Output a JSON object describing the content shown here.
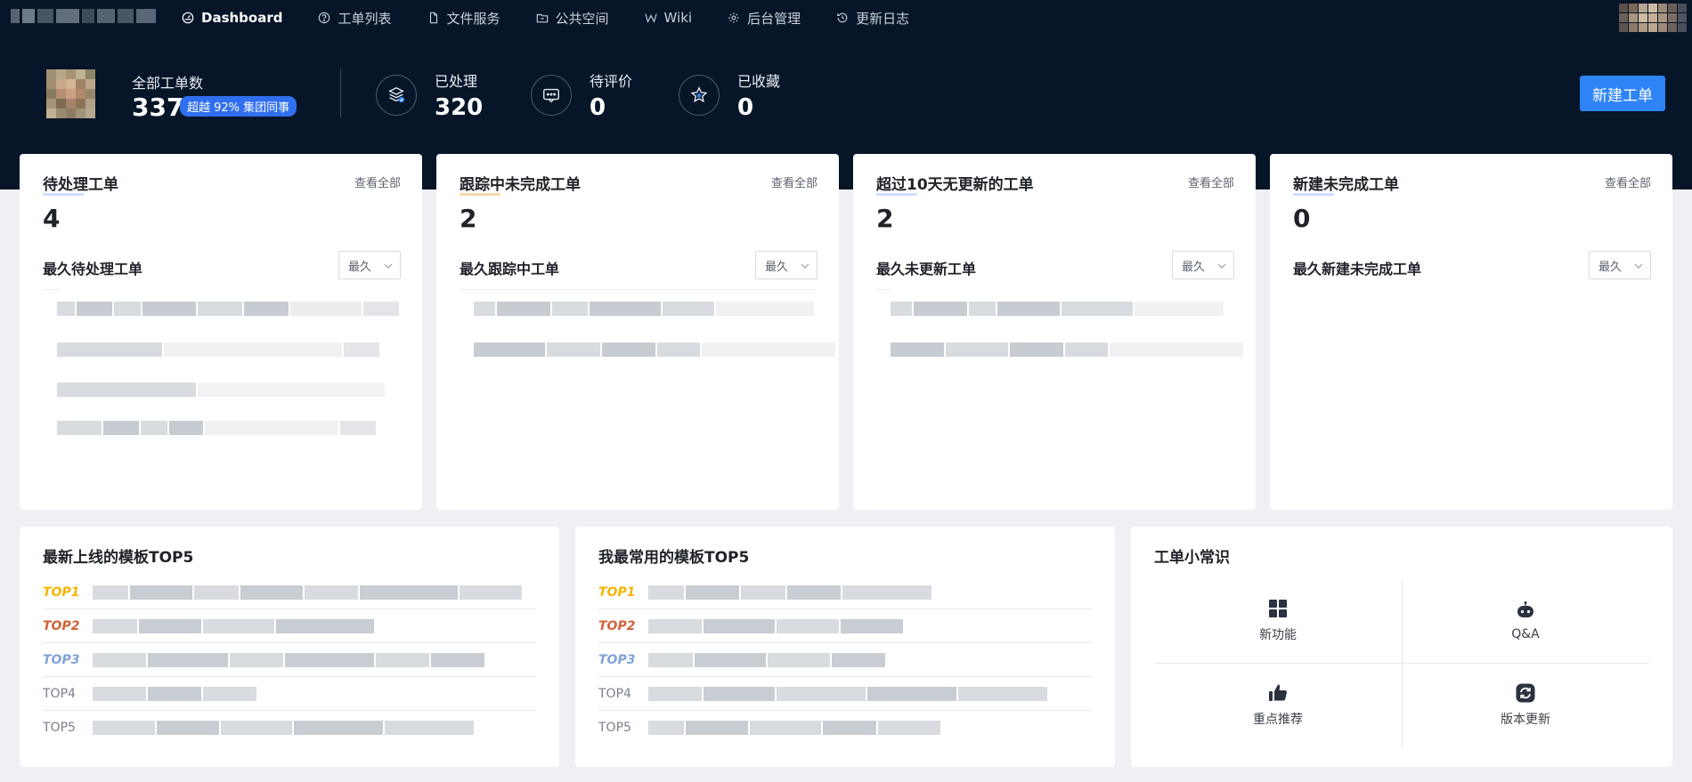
{
  "colors": {
    "header_bg": "#061528",
    "accent": "#2f84f5",
    "badge": "#2f6ff0",
    "top1": "#f5b400",
    "top2": "#d0623a",
    "top3": "#7fa3d6"
  },
  "nav": {
    "items": [
      {
        "label": "Dashboard",
        "icon": "dashboard-icon",
        "active": true
      },
      {
        "label": "工单列表",
        "icon": "help-circle-icon"
      },
      {
        "label": "文件服务",
        "icon": "file-icon"
      },
      {
        "label": "公共空间",
        "icon": "folder-icon"
      },
      {
        "label": "Wiki",
        "icon": "wiki-icon"
      },
      {
        "label": "后台管理",
        "icon": "gear-icon"
      },
      {
        "label": "更新日志",
        "icon": "history-icon"
      }
    ]
  },
  "summary": {
    "total_label": "全部工单数",
    "total_value": "337",
    "total_badge": "超越 92% 集团同事",
    "stats": [
      {
        "label": "已处理",
        "value": "320",
        "icon": "layers-check-icon"
      },
      {
        "label": "待评价",
        "value": "0",
        "icon": "message-icon"
      },
      {
        "label": "已收藏",
        "value": "0",
        "icon": "star-icon"
      }
    ],
    "new_button": "新建工单"
  },
  "cards": [
    {
      "title": "待处理工单",
      "view_all": "查看全部",
      "count": "4",
      "sub_title": "最久待处理工单",
      "sort": "最久"
    },
    {
      "title": "跟踪中未完成工单",
      "view_all": "查看全部",
      "count": "2",
      "sub_title": "最久跟踪中工单",
      "sort": "最久"
    },
    {
      "title": "超过10天无更新的工单",
      "view_all": "查看全部",
      "count": "2",
      "sub_title": "最久未更新工单",
      "sort": "最久"
    },
    {
      "title": "新建未完成工单",
      "view_all": "查看全部",
      "count": "0",
      "sub_title": "最久新建未完成工单",
      "sort": "最久"
    }
  ],
  "latest_templates": {
    "title": "最新上线的模板TOP5",
    "rows": [
      "TOP1",
      "TOP2",
      "TOP3",
      "TOP4",
      "TOP5"
    ]
  },
  "frequent_templates": {
    "title": "我最常用的模板TOP5",
    "rows": [
      "TOP1",
      "TOP2",
      "TOP3",
      "TOP4",
      "TOP5"
    ]
  },
  "tips": {
    "title": "工单小常识",
    "items": [
      {
        "label": "新功能",
        "icon": "grid-icon"
      },
      {
        "label": "Q&A",
        "icon": "robot-icon"
      },
      {
        "label": "重点推荐",
        "icon": "thumbs-up-icon"
      },
      {
        "label": "版本更新",
        "icon": "refresh-icon"
      }
    ]
  }
}
